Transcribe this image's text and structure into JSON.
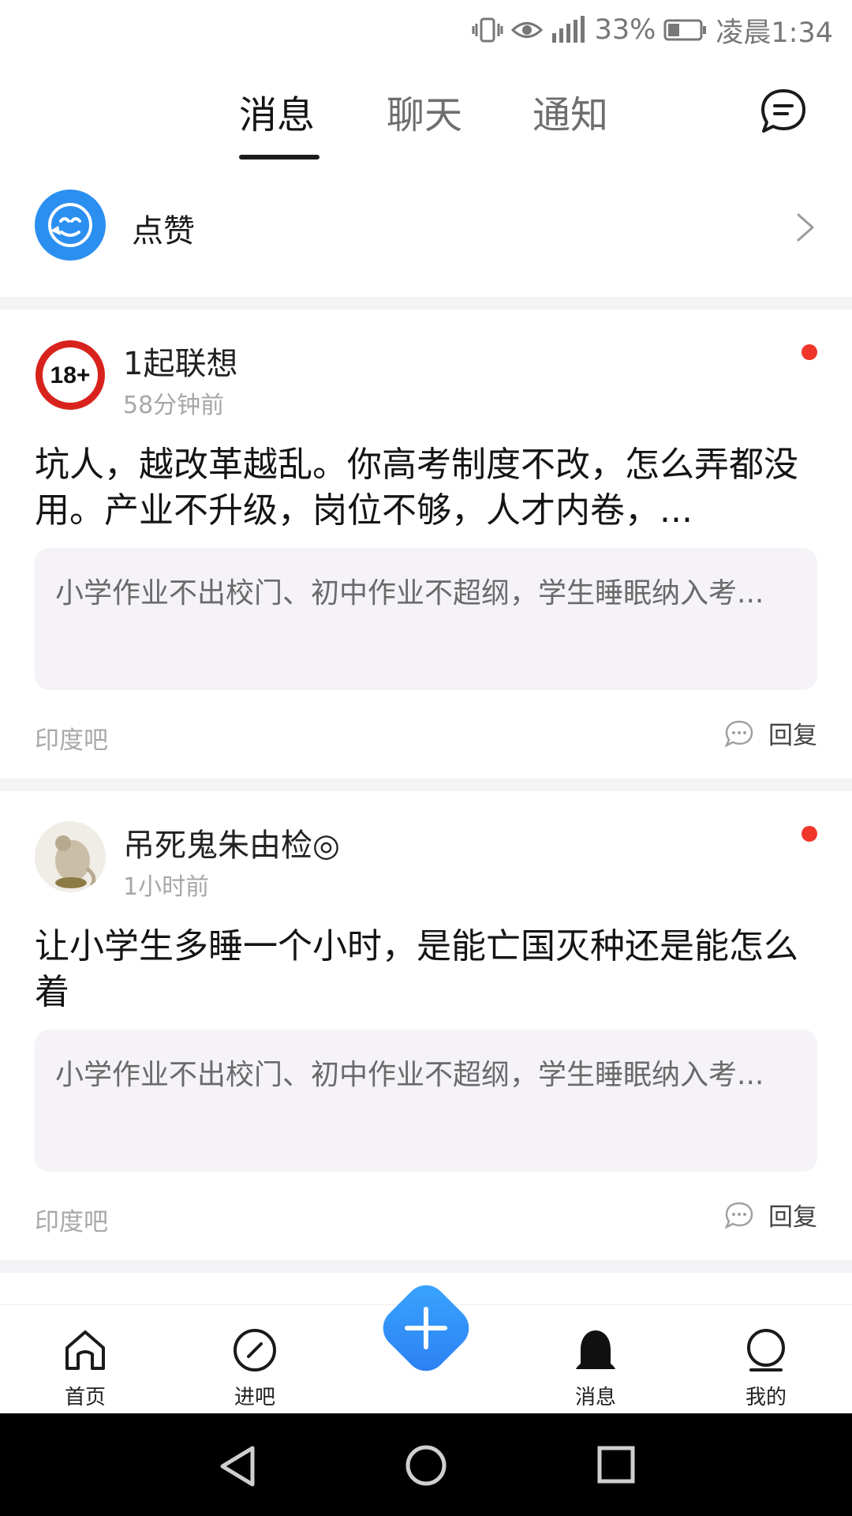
{
  "status_bar": {
    "battery": "33%",
    "time": "凌晨1:34"
  },
  "header": {
    "tabs": [
      {
        "label": "消息",
        "active": true
      },
      {
        "label": "聊天",
        "active": false
      },
      {
        "label": "通知",
        "active": false
      }
    ]
  },
  "likes": {
    "label": "点赞"
  },
  "posts": [
    {
      "author": "1起联想",
      "time": "58分钟前",
      "content": "坑人，越改革越乱。你高考制度不改，怎么弄都没用。产业不升级，岗位不够，人才内卷，...",
      "quote": "小学作业不出校门、初中作业不超纲，学生睡眠纳入考...",
      "forum": "印度吧",
      "reply_label": "回复",
      "unread": true
    },
    {
      "author": "吊死鬼朱由检◎",
      "time": "1小时前",
      "content": "让小学生多睡一个小时，是能亡国灭种还是能怎么着",
      "quote": "小学作业不出校门、初中作业不超纲，学生睡眠纳入考...",
      "forum": "印度吧",
      "reply_label": "回复",
      "unread": true
    }
  ],
  "bottom_nav": {
    "items": [
      {
        "label": "首页",
        "icon": "home-icon"
      },
      {
        "label": "进吧",
        "icon": "compass-icon"
      },
      {
        "label": "消息",
        "icon": "bell-icon",
        "active": true
      },
      {
        "label": "我的",
        "icon": "profile-icon"
      }
    ],
    "fab_icon": "plus-icon"
  },
  "colors": {
    "accent": "#2b8ff0",
    "unread_dot": "#f0362b",
    "quote_bg": "#f5f3f7"
  }
}
